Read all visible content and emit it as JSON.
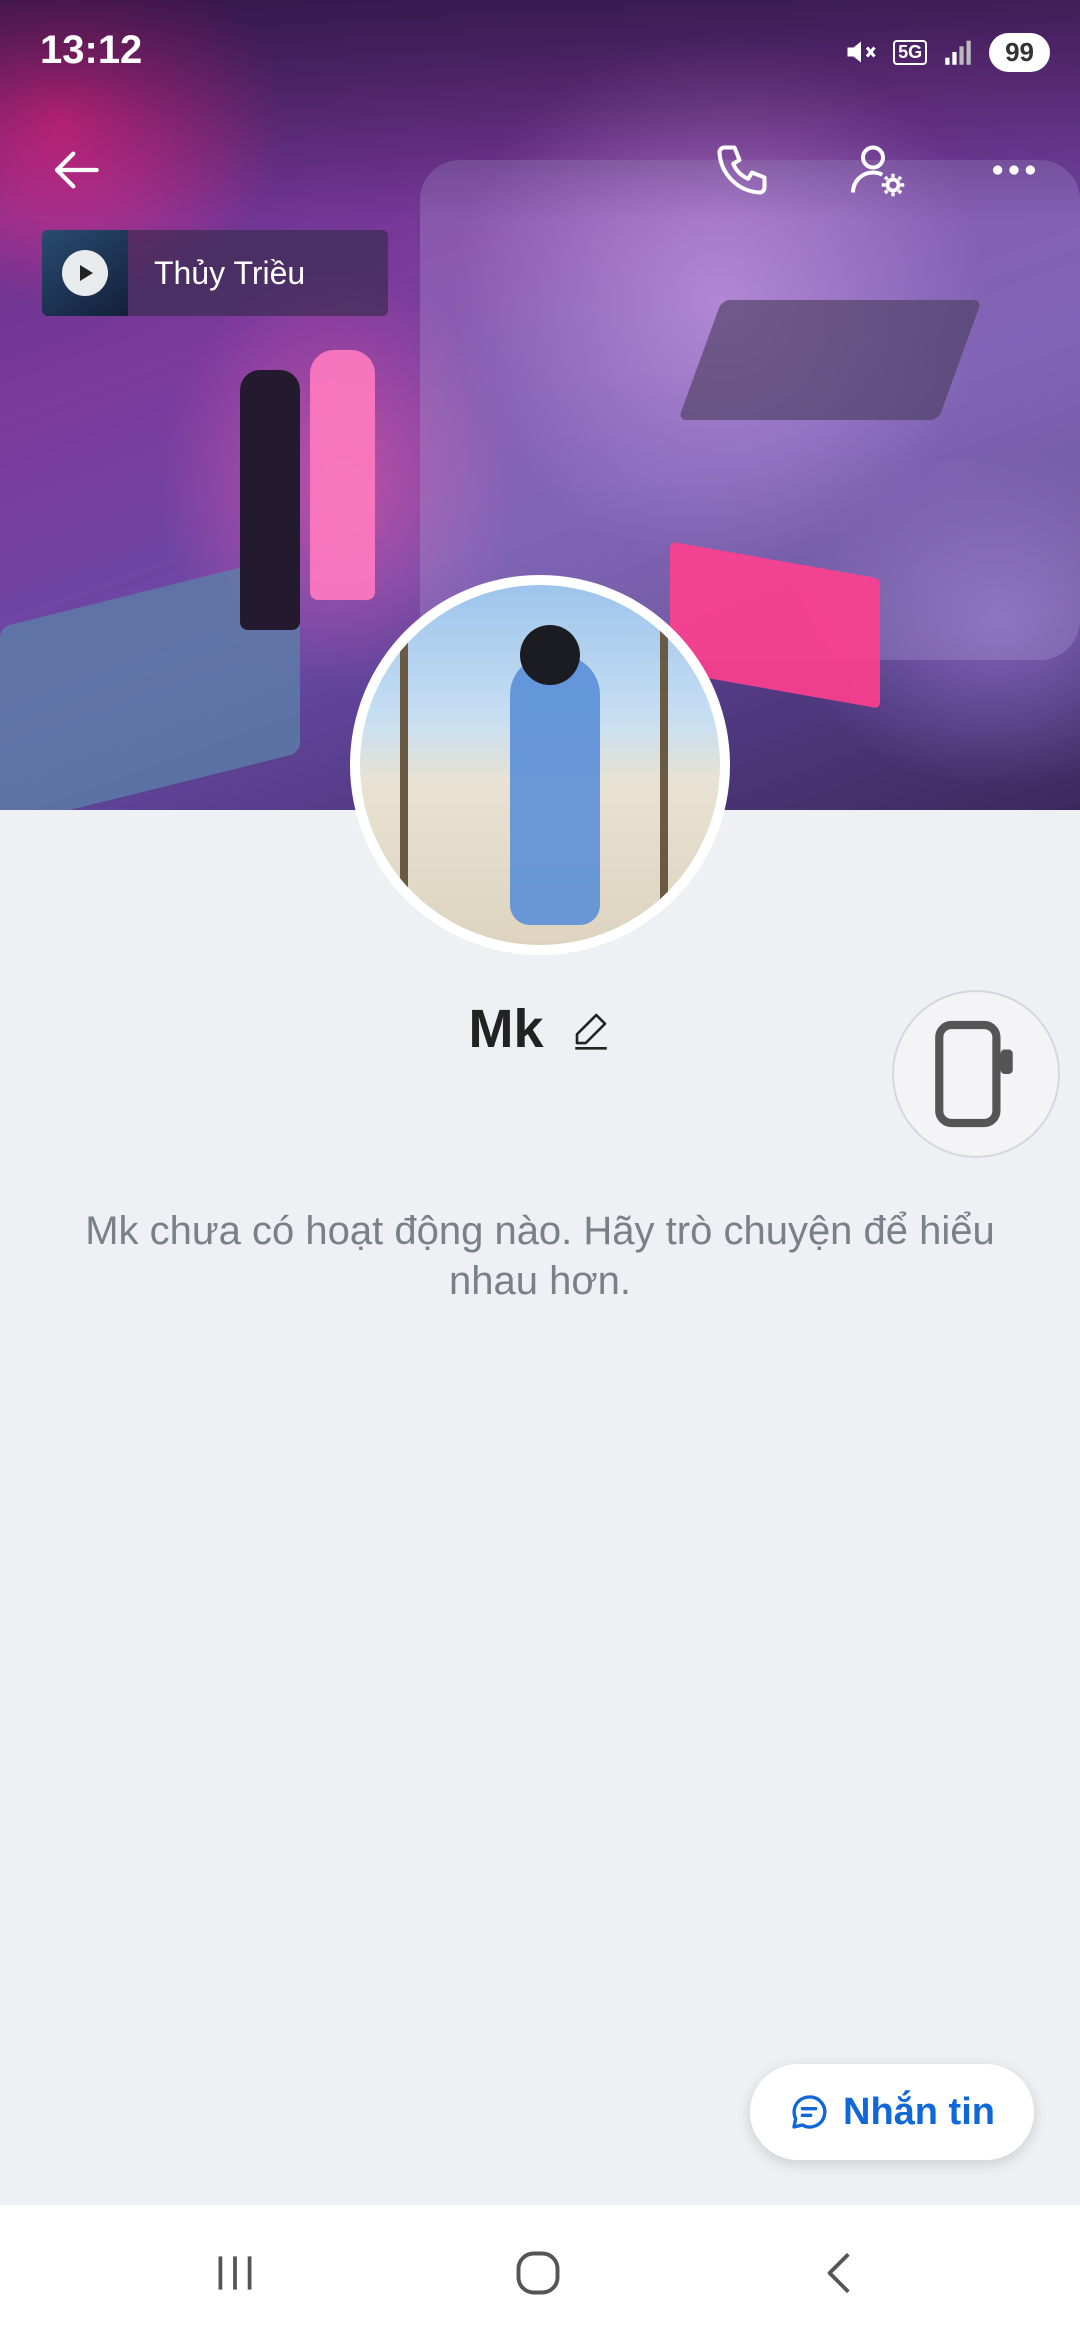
{
  "status_bar": {
    "time": "13:12",
    "network": "5G",
    "battery": "99"
  },
  "header": {
    "back_icon": "arrow-left-icon",
    "call_icon": "phone-icon",
    "settings_icon": "user-settings-icon",
    "more_icon": "more-horizontal-icon"
  },
  "music": {
    "title": "Thủy Triều",
    "icon": "play-icon"
  },
  "profile": {
    "name": "Mk",
    "edit_icon": "pencil-icon",
    "device_icon": "phone-device-icon"
  },
  "empty_state": {
    "message": "Mk chưa có hoạt động nào. Hãy trò chuyện để hiểu nhau hơn."
  },
  "chat_button": {
    "label": "Nhắn tin",
    "icon": "chat-bubble-icon",
    "color": "#1068d8"
  },
  "navbar": {
    "items": [
      "recent-apps-icon",
      "home-icon",
      "back-icon"
    ]
  }
}
